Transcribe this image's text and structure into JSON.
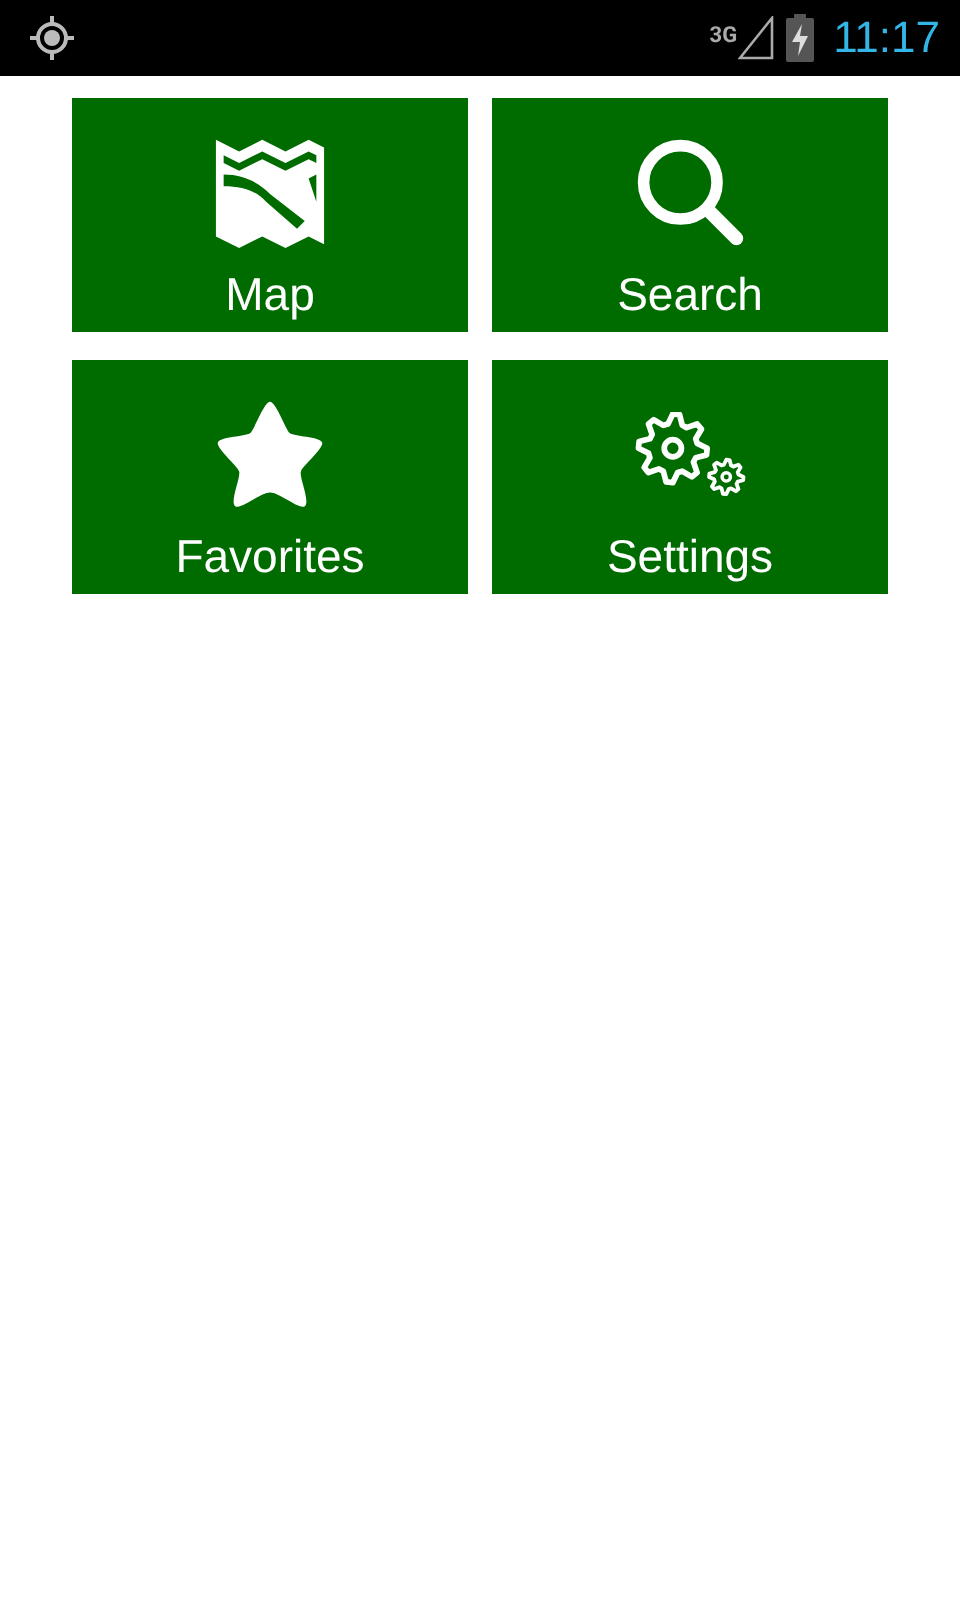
{
  "status_bar": {
    "network": "3G",
    "time": "11:17"
  },
  "tiles": [
    {
      "kind": "map",
      "label": "Map"
    },
    {
      "kind": "search",
      "label": "Search"
    },
    {
      "kind": "favorites",
      "label": "Favorites"
    },
    {
      "kind": "settings",
      "label": "Settings"
    }
  ]
}
